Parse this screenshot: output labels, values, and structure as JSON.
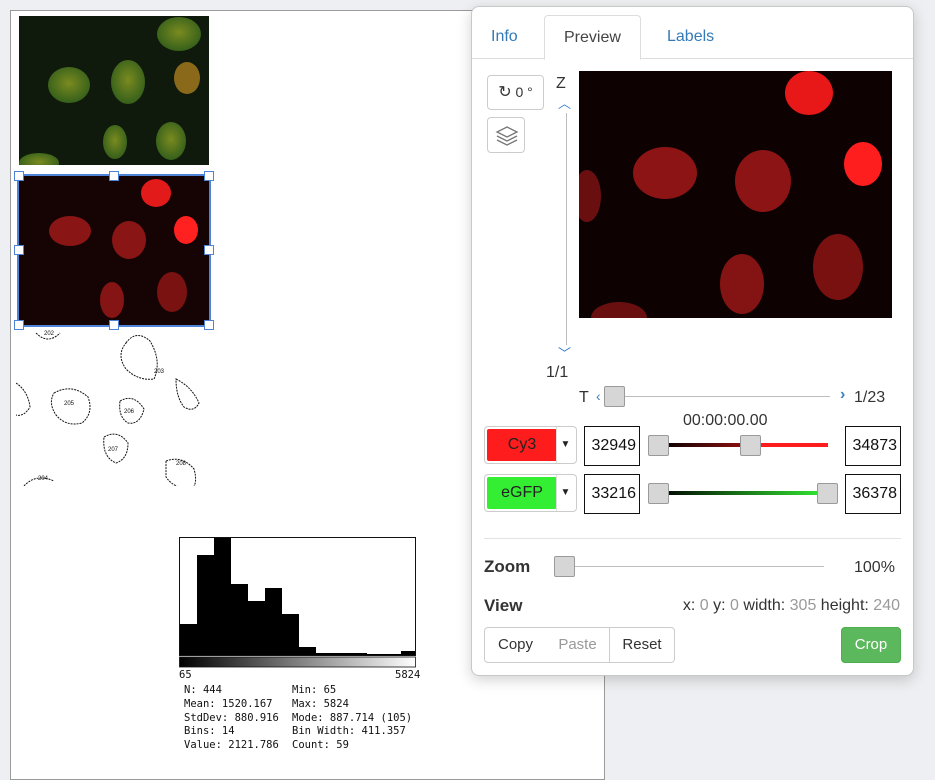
{
  "tabs": [
    {
      "label": "Info"
    },
    {
      "label": "Preview"
    },
    {
      "label": "Labels"
    }
  ],
  "preview": {
    "rotation_label": "0 °",
    "z_label": "Z",
    "z_value": "1/1",
    "t_label": "T",
    "t_value": "1/23",
    "timestamp": "00:00:00.00",
    "channels": [
      {
        "name": "Cy3",
        "color": "#ff1a1a",
        "min": "32949",
        "max": "34873"
      },
      {
        "name": "eGFP",
        "color": "#22ee22",
        "min": "33216",
        "max": "36378"
      }
    ],
    "zoom_label": "Zoom",
    "zoom_value": "100%",
    "view_label": "View",
    "view": {
      "x_label": "x:",
      "x": "0",
      "y_label": "y:",
      "y": "0",
      "width_label": "width:",
      "width": "305",
      "height_label": "height:",
      "height": "240"
    },
    "buttons": {
      "copy": "Copy",
      "paste": "Paste",
      "reset": "Reset",
      "crop": "Crop"
    }
  },
  "histogram": {
    "min_tick": "65",
    "max_tick": "5824",
    "stats_left": [
      "N: 444",
      "Mean: 1520.167",
      "StdDev: 880.916",
      "Bins: 14",
      "Value: 2121.786"
    ],
    "stats_right": [
      "Min: 65",
      "Max: 5824",
      "Mode: 887.714 (105)",
      "Bin Width: 411.357",
      "Count: 59"
    ]
  },
  "roi_labels": [
    "202",
    "203",
    "205",
    "206",
    "207",
    "208",
    "204"
  ]
}
